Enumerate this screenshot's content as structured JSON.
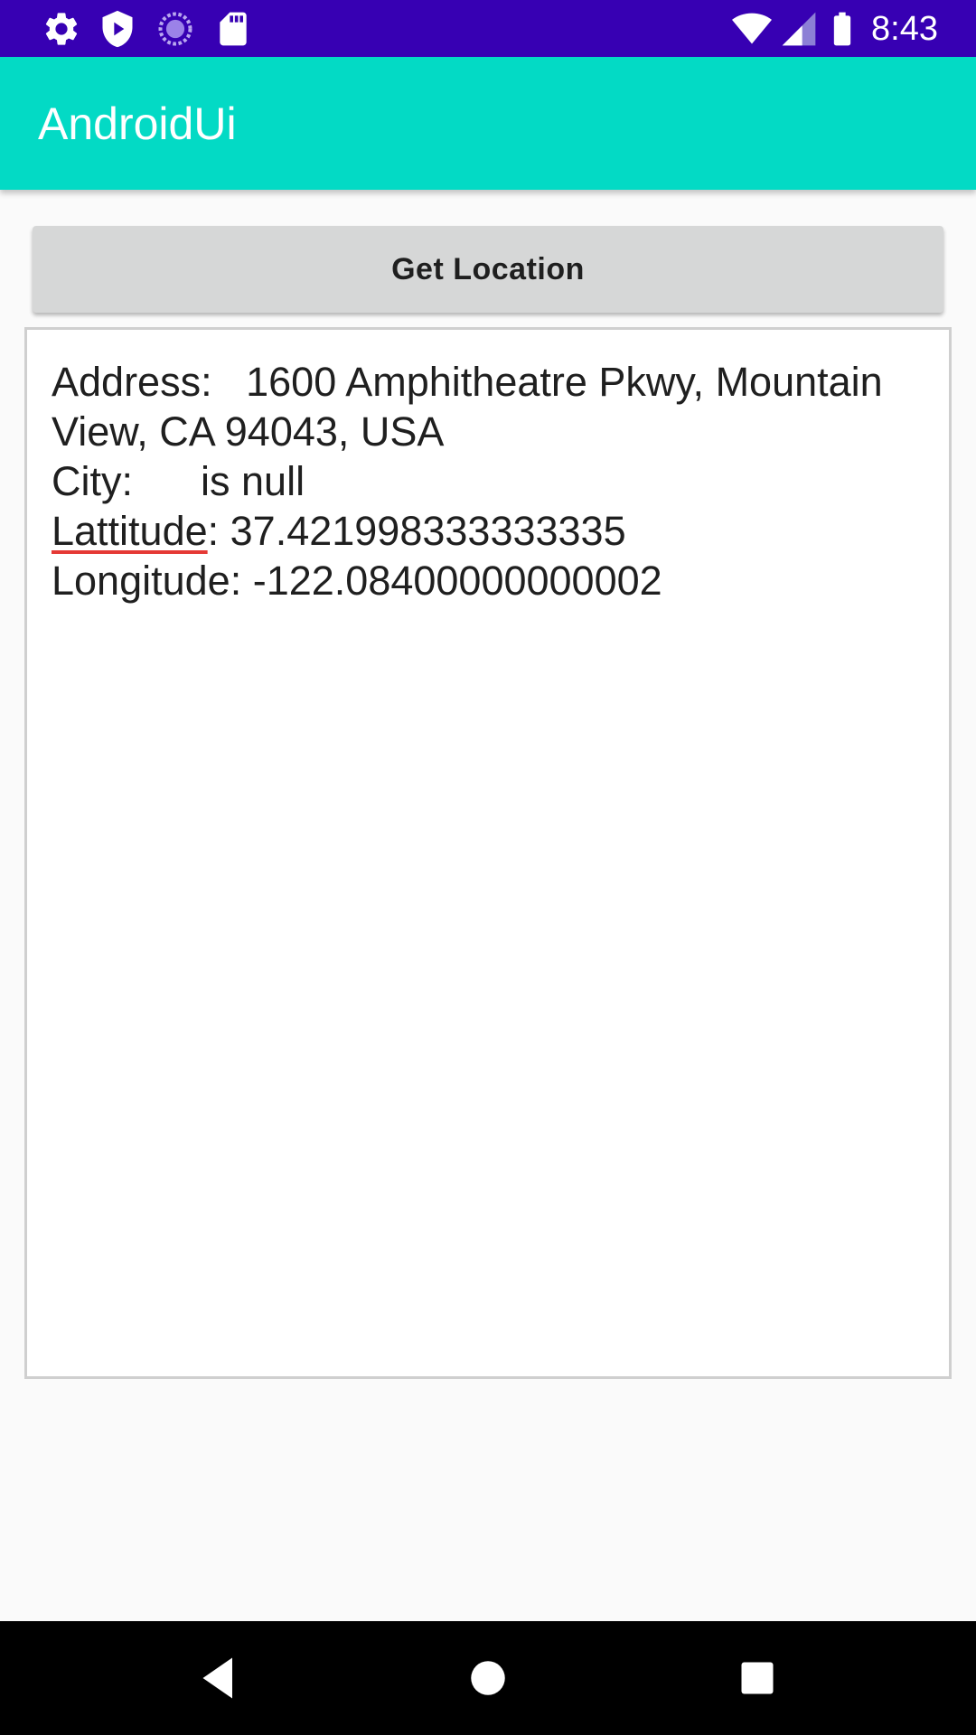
{
  "status_bar": {
    "time": "8:43",
    "left_icons": [
      "settings-icon",
      "shield-icon",
      "sync-icon",
      "sd-card-icon"
    ],
    "right_icons": [
      "wifi-icon",
      "signal-icon",
      "battery-icon"
    ],
    "background_color": "#3700b3"
  },
  "app_bar": {
    "title": "AndroidUi",
    "background_color": "#03dac5"
  },
  "main": {
    "button_label": "Get Location",
    "result": {
      "address_label": "Address:",
      "address_value": "1600 Amphitheatre Pkwy, Mountain View, CA 94043, USA",
      "city_label": "City:",
      "city_value": "is null",
      "latitude_label": "Lattitude",
      "latitude_value": ": 37.421998333333335",
      "longitude_label": "Longitude:",
      "longitude_value": "-122.08400000000002"
    }
  },
  "nav_bar": {
    "buttons": [
      "back-icon",
      "home-icon",
      "recents-icon"
    ]
  }
}
